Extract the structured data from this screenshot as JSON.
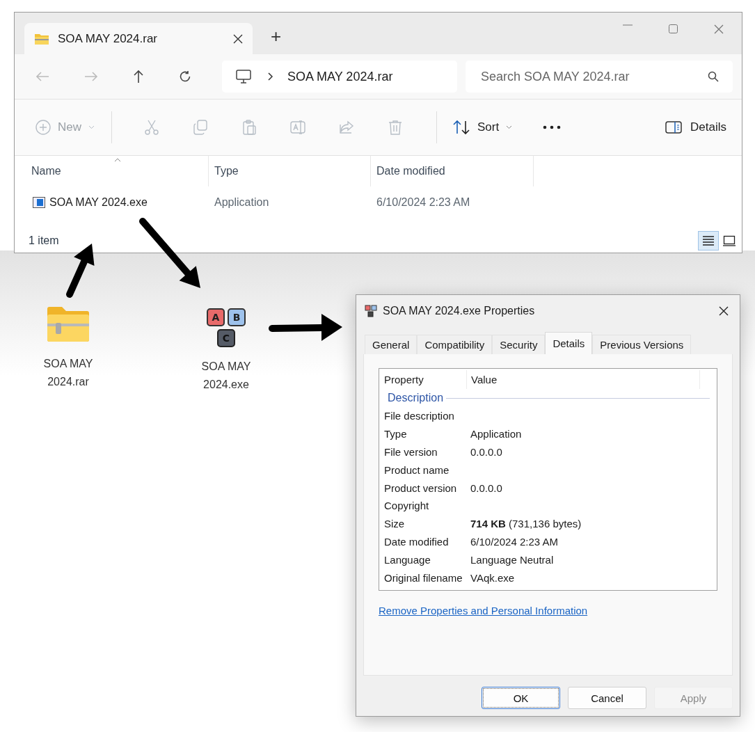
{
  "explorer": {
    "tabs": [
      {
        "title": "SOA MAY 2024.rar",
        "selected": true
      }
    ],
    "new_tab": "+",
    "breadcrumb": "SOA MAY 2024.rar",
    "search": {
      "placeholder": "Search SOA MAY 2024.rar"
    },
    "new_button": {
      "label": "New",
      "disabled": true
    },
    "actions": [
      {
        "kind": "cut",
        "disabled": true
      },
      {
        "kind": "copy",
        "disabled": true
      },
      {
        "kind": "paste",
        "disabled": true
      },
      {
        "kind": "rename",
        "disabled": true
      },
      {
        "kind": "share",
        "disabled": true
      },
      {
        "kind": "delete",
        "disabled": true
      }
    ],
    "sort": "Sort",
    "details_button": "Details",
    "columns": [
      "Name",
      "Type",
      "Date modified"
    ],
    "rows": [
      {
        "name": "SOA MAY 2024.exe",
        "type": "Application",
        "date": "6/10/2024 2:23 AM"
      }
    ],
    "status": "1 item",
    "views": [
      {
        "kind": "details",
        "selected": true
      },
      {
        "kind": "tiles",
        "selected": false
      }
    ]
  },
  "desktop_icons": [
    {
      "kind": "archive",
      "label": "SOA MAY 2024.rar"
    },
    {
      "kind": "program",
      "label": "SOA MAY 2024.exe",
      "letters": [
        "A",
        "B",
        "C"
      ]
    }
  ],
  "dialog": {
    "title": "SOA MAY 2024.exe Properties",
    "tabs": [
      {
        "label": "General",
        "selected": false
      },
      {
        "label": "Compatibility",
        "selected": false
      },
      {
        "label": "Security",
        "selected": false
      },
      {
        "label": "Details",
        "selected": true
      },
      {
        "label": "Previous Versions",
        "selected": false
      }
    ],
    "columns": [
      "Property",
      "Value"
    ],
    "group": "Description",
    "properties": [
      {
        "name": "File description"
      },
      {
        "name": "Type",
        "value": "Application"
      },
      {
        "name": "File version",
        "value": "0.0.0.0"
      },
      {
        "name": "Product name"
      },
      {
        "name": "Product version",
        "value": "0.0.0.0"
      },
      {
        "name": "Copyright"
      },
      {
        "name": "Size",
        "value": "**714 KB** (731,136 bytes)"
      },
      {
        "name": "Date modified",
        "value": "6/10/2024 2:23 AM"
      },
      {
        "name": "Language",
        "value": "Language Neutral"
      },
      {
        "name": "Original filename",
        "value": "VAqk.exe"
      }
    ],
    "link": "Remove Properties and Personal Information",
    "buttons": [
      {
        "label": "OK",
        "focused": true,
        "disabled": false
      },
      {
        "label": "Cancel",
        "focused": false,
        "disabled": false
      },
      {
        "label": "Apply",
        "focused": false,
        "disabled": true
      }
    ]
  }
}
